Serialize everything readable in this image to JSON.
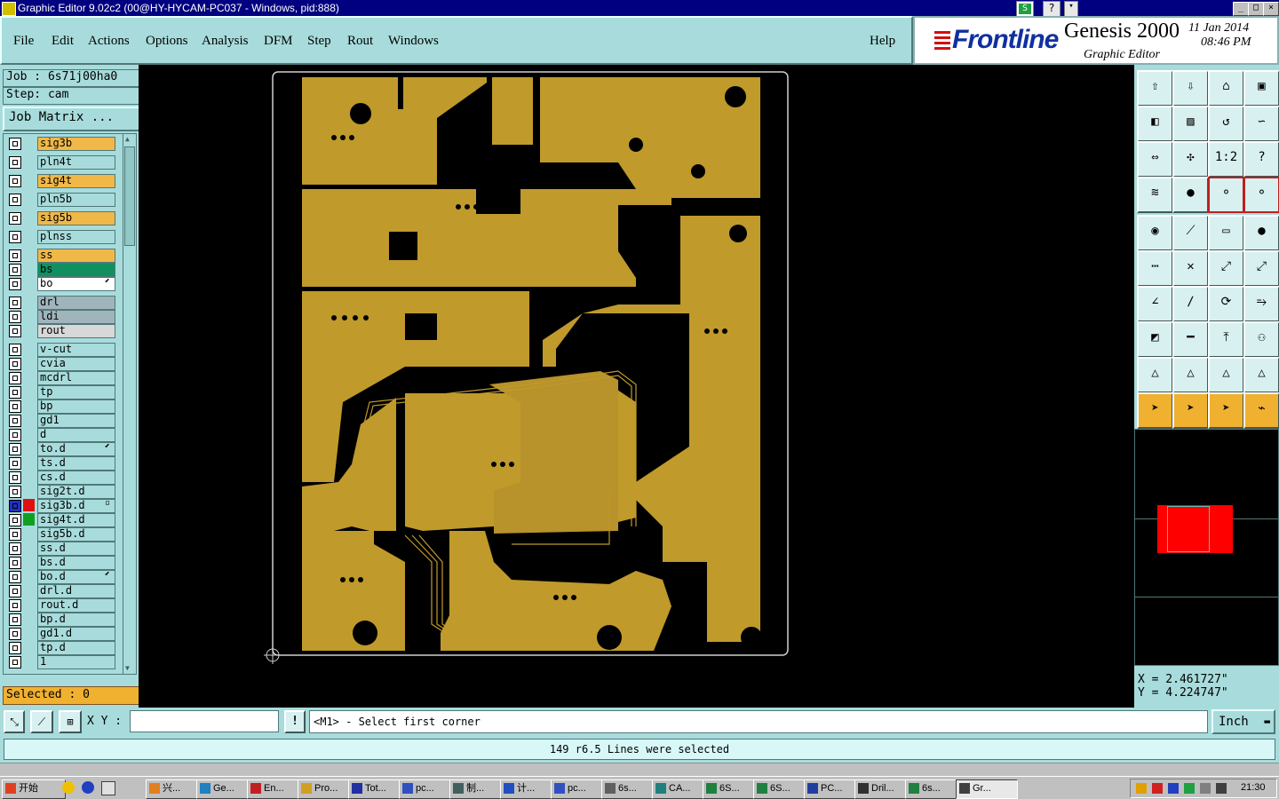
{
  "window": {
    "title": "Graphic Editor 9.02c2 (00@HY-HYCAM-PC037 - Windows, pid:888)"
  },
  "menu": [
    "File",
    "Edit",
    "Actions",
    "Options",
    "Analysis",
    "DFM",
    "Step",
    "Rout",
    "Windows"
  ],
  "menu_help": "Help",
  "brand": {
    "logo": "Frontline",
    "product": "Genesis 2000",
    "subtitle": "Graphic Editor",
    "date": "11 Jan 2014",
    "time": "08:46 PM"
  },
  "job": {
    "job": "Job : 6s71j00ha0",
    "step": "Step: cam",
    "matrix_button": "Job Matrix ..."
  },
  "layers": [
    {
      "name": "sig3b",
      "bg": "#f0b848"
    },
    {
      "name": "pln4t",
      "bg": "#a8dcdc"
    },
    {
      "name": "sig4t",
      "bg": "#f0b848"
    },
    {
      "name": "pln5b",
      "bg": "#a8dcdc"
    },
    {
      "name": "sig5b",
      "bg": "#f0b848"
    },
    {
      "name": "plnss",
      "bg": "#a8dcdc"
    },
    {
      "name": "ss",
      "bg": "#f0b848"
    },
    {
      "name": "bs",
      "bg": "#109060"
    },
    {
      "name": "bo",
      "bg": "#ffffff",
      "mark": "⬋"
    },
    {
      "name": "drl",
      "bg": "#a0b4bc"
    },
    {
      "name": "ldi",
      "bg": "#a0b4bc"
    },
    {
      "name": "rout",
      "bg": "#d8d8d8"
    },
    {
      "name": "v-cut",
      "bg": "#a8dcdc"
    },
    {
      "name": "cvia",
      "bg": "#a8dcdc"
    },
    {
      "name": "mcdrl",
      "bg": "#a8dcdc"
    },
    {
      "name": "tp",
      "bg": "#a8dcdc"
    },
    {
      "name": "bp",
      "bg": "#a8dcdc"
    },
    {
      "name": "gd1",
      "bg": "#a8dcdc"
    },
    {
      "name": "d",
      "bg": "#a8dcdc"
    },
    {
      "name": "to.d",
      "bg": "#a8dcdc",
      "mark": "⬋"
    },
    {
      "name": "ts.d",
      "bg": "#a8dcdc"
    },
    {
      "name": "cs.d",
      "bg": "#a8dcdc"
    },
    {
      "name": "sig2t.d",
      "bg": "#a8dcdc"
    },
    {
      "name": "sig3b.d",
      "bg": "#a8dcdc",
      "color": "#e01010",
      "mark": "▫",
      "active": true
    },
    {
      "name": "sig4t.d",
      "bg": "#a8dcdc",
      "color": "#10a020"
    },
    {
      "name": "sig5b.d",
      "bg": "#a8dcdc"
    },
    {
      "name": "ss.d",
      "bg": "#a8dcdc"
    },
    {
      "name": "bs.d",
      "bg": "#a8dcdc"
    },
    {
      "name": "bo.d",
      "bg": "#a8dcdc",
      "mark": "⬋"
    },
    {
      "name": "drl.d",
      "bg": "#a8dcdc"
    },
    {
      "name": "rout.d",
      "bg": "#a8dcdc"
    },
    {
      "name": "bp.d",
      "bg": "#a8dcdc"
    },
    {
      "name": "gd1.d",
      "bg": "#a8dcdc"
    },
    {
      "name": "tp.d",
      "bg": "#a8dcdc"
    },
    {
      "name": "1",
      "bg": "#a8dcdc"
    }
  ],
  "selected": "Selected : 0",
  "toolbox": {
    "icons": [
      "zoom-home-icon",
      "zoom-in-icon",
      "home-icon",
      "window-icon",
      "pan-left-icon",
      "pan-right-icon",
      "rotate-icon",
      "mirror-icon",
      "fit-icon",
      "center-icon",
      "scale-icon",
      "help-icon",
      "settings-icon",
      "snap-icon",
      "net-icon",
      "net-alt-icon",
      "pad-icon",
      "draw-icon",
      "measure-icon",
      "dot-icon",
      "connect-icon",
      "cross-icon",
      "node-icon",
      "node-alt-icon",
      "angle-icon",
      "line-icon",
      "arc-icon",
      "font-icon",
      "place-icon",
      "cut-icon",
      "dimension-icon",
      "group-icon",
      "triangle-icon",
      "triangle-alt-icon",
      "triangle-red-icon",
      "triangle-cut-icon",
      "pointer-icon",
      "pointer-box-icon",
      "pointer-red-icon",
      "route-icon"
    ],
    "scale_label": "1:2",
    "help_label": "?"
  },
  "coords": {
    "x": "X = 2.461727\"",
    "y": "Y = 4.224747\""
  },
  "cmd": {
    "xy_label": "X Y :",
    "xy_value": "",
    "alert": "!",
    "prompt": "<M1> - Select first corner",
    "unit": "Inch"
  },
  "status": "149 r6.5 Lines were selected",
  "taskbar": {
    "start": "开始",
    "tasks": [
      "兴...",
      "Ge...",
      "En...",
      "Pro...",
      "Tot...",
      "pc...",
      "制...",
      "计...",
      "pc...",
      "6s...",
      "CA...",
      "6S...",
      "6S...",
      "PC...",
      "Dril...",
      "6s...",
      "Gr..."
    ],
    "clock": "21:30"
  },
  "colors": {
    "board": "#c09a2a",
    "canvas": "#000000",
    "panel": "#a8dcdc",
    "accent": "#f0b030"
  }
}
